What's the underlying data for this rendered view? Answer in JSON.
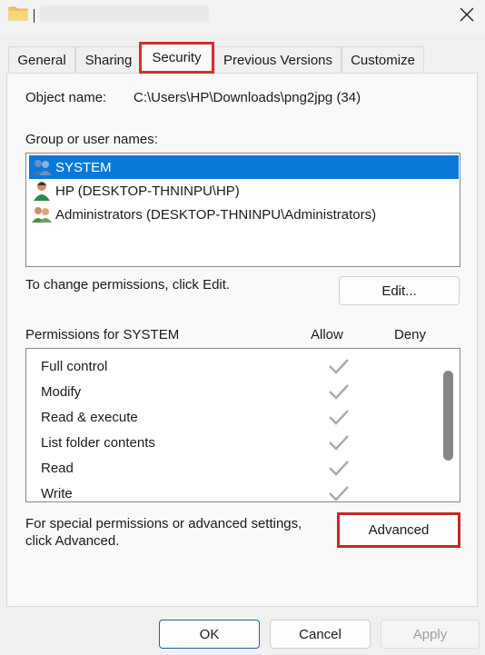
{
  "window": {
    "title": "",
    "close_symbol": "✕"
  },
  "tabs": [
    {
      "label": "General"
    },
    {
      "label": "Sharing"
    },
    {
      "label": "Security"
    },
    {
      "label": "Previous Versions"
    },
    {
      "label": "Customize"
    }
  ],
  "object": {
    "label": "Object name:",
    "value": "C:\\Users\\HP\\Downloads\\png2jpg (34)"
  },
  "group_label": "Group or user names:",
  "users": [
    {
      "name": "SYSTEM",
      "selected": true
    },
    {
      "name": "HP (DESKTOP-THNINPU\\HP)",
      "selected": false
    },
    {
      "name": "Administrators (DESKTOP-THNINPU\\Administrators)",
      "selected": false
    }
  ],
  "change_text": "To change permissions, click Edit.",
  "edit_label": "Edit...",
  "permissions": {
    "header": "Permissions for SYSTEM",
    "allow_label": "Allow",
    "deny_label": "Deny",
    "rows": [
      {
        "name": "Full control",
        "allow": true,
        "deny": false
      },
      {
        "name": "Modify",
        "allow": true,
        "deny": false
      },
      {
        "name": "Read & execute",
        "allow": true,
        "deny": false
      },
      {
        "name": "List folder contents",
        "allow": true,
        "deny": false
      },
      {
        "name": "Read",
        "allow": true,
        "deny": false
      },
      {
        "name": "Write",
        "allow": true,
        "deny": false
      }
    ]
  },
  "advanced": {
    "text_line1": "For special permissions or advanced settings,",
    "text_line2": "click Advanced.",
    "button_label": "Advanced"
  },
  "footer": {
    "ok_label": "OK",
    "cancel_label": "Cancel",
    "apply_label": "Apply"
  },
  "colors": {
    "selection": "#0a78d7",
    "highlight": "#d32f2f",
    "check": "#a8a8a8"
  }
}
